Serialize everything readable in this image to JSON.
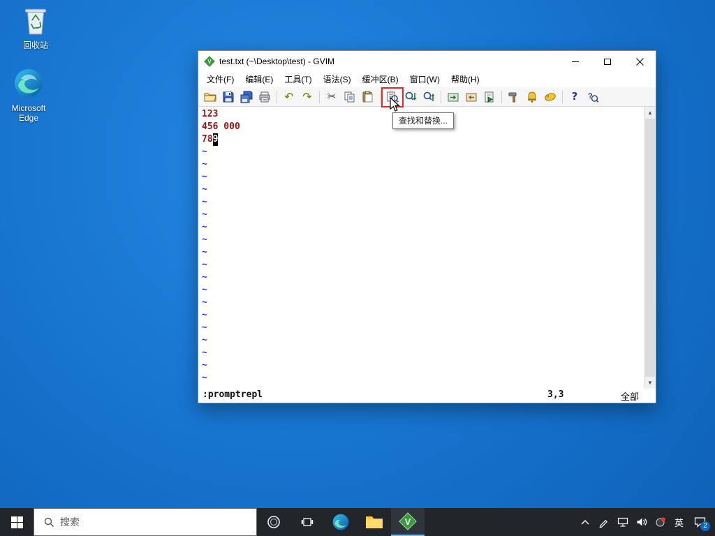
{
  "desktop": {
    "recycle_bin_label": "回收站",
    "edge_label": "Microsoft Edge"
  },
  "gvim": {
    "title": "test.txt (~\\Desktop\\test) - GVIM",
    "menu_items": [
      "文件(F)",
      "编辑(E)",
      "工具(T)",
      "语法(S)",
      "缓冲区(B)",
      "窗口(W)",
      "帮助(H)"
    ],
    "toolbar_items": [
      "open",
      "save",
      "save-all",
      "print",
      "undo",
      "redo",
      "cut",
      "copy",
      "paste",
      "replace",
      "find-next",
      "find-prev",
      "session-load",
      "session-save",
      "run-script",
      "make",
      "build-tags",
      "tag-jump",
      "help",
      "find-help"
    ],
    "tooltip": "查找和替换...",
    "buffer": {
      "line1": "123",
      "line2": "456 000",
      "line3_before_cursor": "78",
      "cursor_char": "9",
      "tilde": "~",
      "tilde_count": 19
    },
    "statusline": {
      "command": ":promptrepl",
      "ruler": "3,3",
      "scroll_position": "全部"
    }
  },
  "taskbar": {
    "search_placeholder": "搜索",
    "ime_indicator": "英",
    "notification_count": "2"
  },
  "colors": {
    "desktop_blue": "#1777d2",
    "taskbar_dark": "#22262b",
    "buffer_text": "#9c1313",
    "tilde_blue": "#3333ee",
    "annotation_red": "#e8281e",
    "active_app_accent": "#76b9ed"
  }
}
